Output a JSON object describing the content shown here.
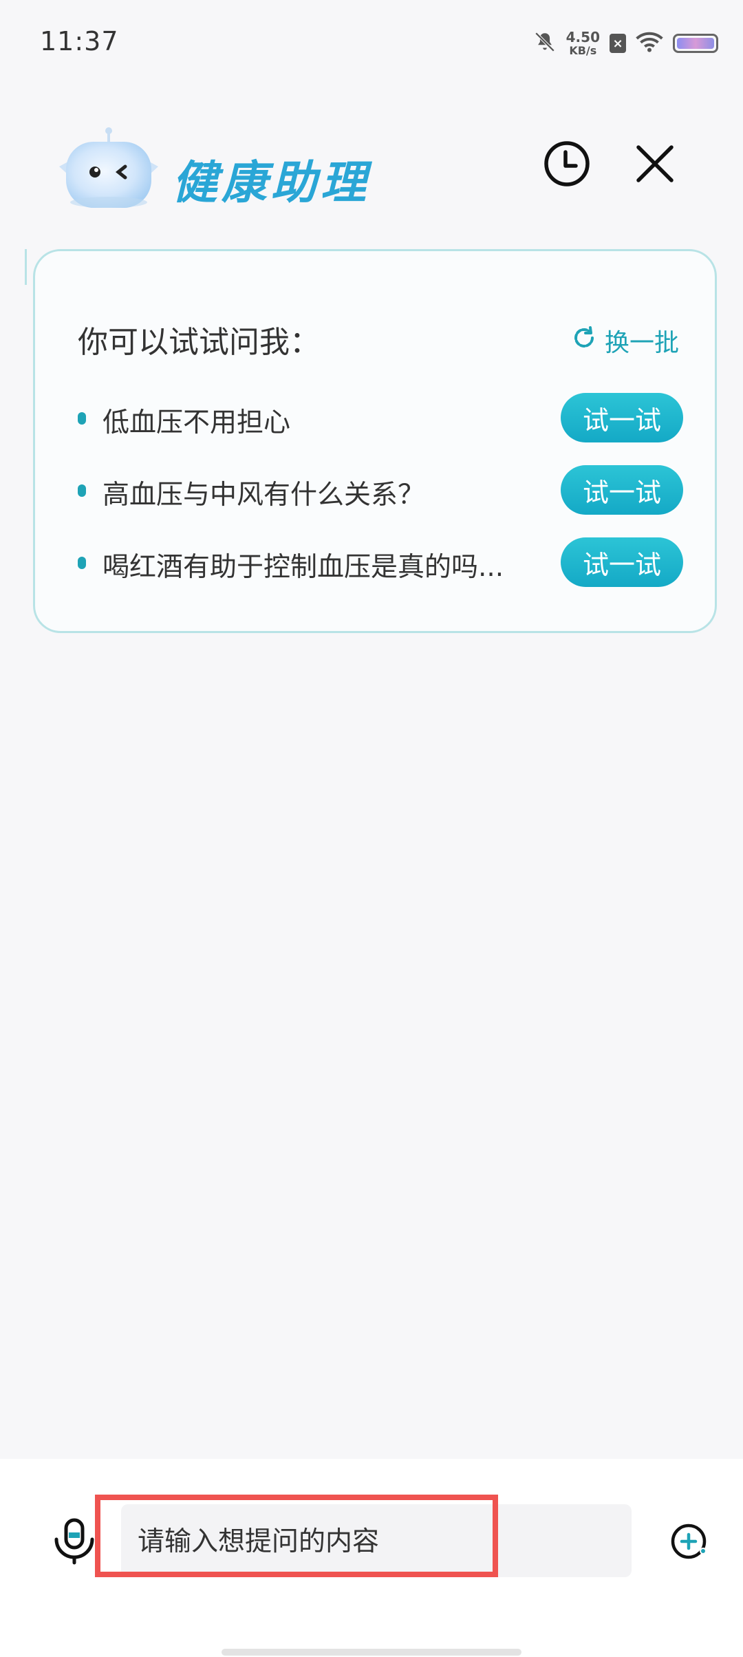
{
  "status_bar": {
    "time": "11:37",
    "net_speed_value": "4.50",
    "net_speed_unit": "KB/s",
    "icons": [
      "mute-bell-icon",
      "sim-x-icon",
      "wifi-icon",
      "battery-icon"
    ]
  },
  "header": {
    "title": "健康助理",
    "mascot": "robot-mascot",
    "actions": [
      "history-clock-icon",
      "close-icon"
    ]
  },
  "suggestions": {
    "title": "你可以试试问我：",
    "refresh_label": "换一批",
    "items": [
      {
        "text": "低血压不用担心",
        "button": "试一试"
      },
      {
        "text": "高血压与中风有什么关系？",
        "button": "试一试"
      },
      {
        "text": "喝红酒有助于控制血压是真的吗...",
        "button": "试一试"
      }
    ]
  },
  "input": {
    "placeholder": "请输入想提问的内容",
    "value": "",
    "mic_icon": "microphone-icon",
    "plus_icon": "plus-circle-icon"
  },
  "colors": {
    "accent": "#1ea3b6",
    "title": "#2aa6d6",
    "button_gradient_top": "#2cc4d6",
    "button_gradient_bottom": "#14a9c6",
    "card_border": "#b8e3e6",
    "highlight": "#ef5350",
    "background": "#f7f7f9"
  }
}
